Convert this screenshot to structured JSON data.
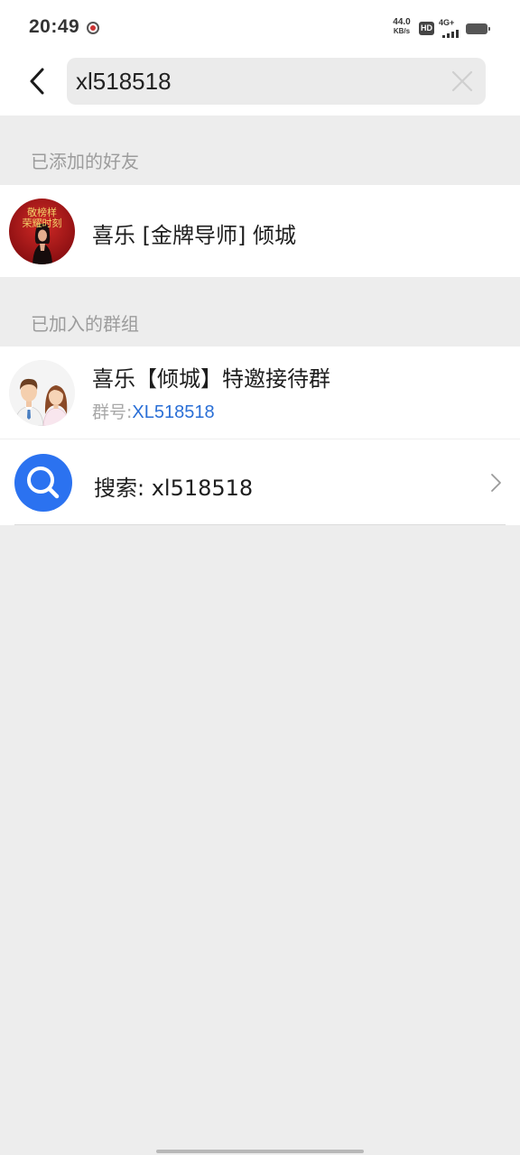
{
  "status_bar": {
    "time": "20:49",
    "net_speed_value": "44.0",
    "net_speed_unit": "KB/s",
    "hd_label": "HD",
    "network_type": "4G+"
  },
  "search": {
    "query": "xl518518",
    "icons": {
      "back": "chevron-left-icon",
      "clear": "close-icon"
    }
  },
  "friends_section": {
    "title": "已添加的好友",
    "items": [
      {
        "name": "喜乐 [金牌导师] 倾城",
        "avatar_text": [
          "敬榜样",
          "荣耀时刻"
        ]
      }
    ]
  },
  "groups_section": {
    "title": "已加入的群组",
    "items": [
      {
        "name": "喜乐【倾城】特邀接待群",
        "id_label": "群号:",
        "id_value": "XL518518"
      }
    ]
  },
  "search_more": {
    "label": "搜索: xl518518",
    "icon": "search-icon",
    "accent_color": "#2b72f0"
  },
  "colors": {
    "background": "#ededed",
    "card": "#ffffff",
    "section_text": "#9c9c9c",
    "highlight": "#2a6fd6",
    "avatar_red": "#b3141c"
  }
}
